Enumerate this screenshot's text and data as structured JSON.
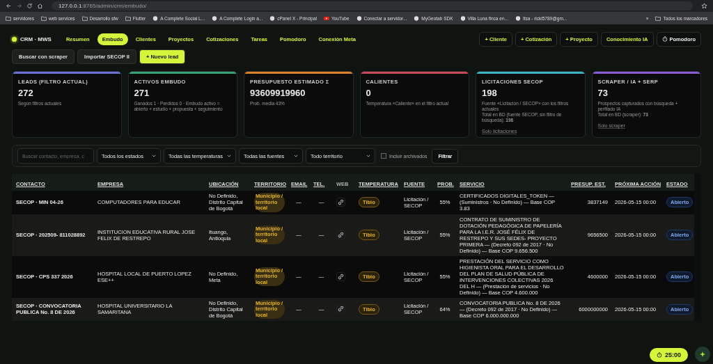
{
  "browser": {
    "url_host": "127.0.0.1",
    "url_path": ":8765/admin/crm/embudo/",
    "bookmarks": [
      {
        "kind": "folder",
        "label": "servidores"
      },
      {
        "kind": "folder",
        "label": "web services"
      },
      {
        "kind": "folder",
        "label": "Desarrollo sfw"
      },
      {
        "kind": "folder",
        "label": "Flutter"
      },
      {
        "kind": "site",
        "label": "A Complete Social L..."
      },
      {
        "kind": "site",
        "label": "A Complete Login a..."
      },
      {
        "kind": "site",
        "label": "cPanel X - Principal"
      },
      {
        "kind": "video",
        "label": "YouTube"
      },
      {
        "kind": "site",
        "label": "Conectar a servidor..."
      },
      {
        "kind": "site",
        "label": "MyGeotab SDK"
      },
      {
        "kind": "site",
        "label": "Villa Luna finca en..."
      },
      {
        "kind": "site",
        "label": "Itsa - ricki5789@gm..."
      }
    ],
    "more": "»",
    "all_bookmarks": "Todos los marcadores"
  },
  "brand": "CRM · MWS",
  "tabs": [
    {
      "label": "Resumen",
      "selected": false
    },
    {
      "label": "Embudo",
      "selected": true
    },
    {
      "label": "Clientes",
      "selected": false
    },
    {
      "label": "Proyectos",
      "selected": false
    },
    {
      "label": "Cotizaciones",
      "selected": false
    },
    {
      "label": "Tareas",
      "selected": false
    },
    {
      "label": "Pomodoro",
      "selected": false
    },
    {
      "label": "Conexión Meta",
      "selected": false
    }
  ],
  "actions": [
    {
      "label": "+ Cliente",
      "kind": "plain"
    },
    {
      "label": "+ Cotización",
      "kind": "plain"
    },
    {
      "label": "+ Proyecto",
      "kind": "plain"
    },
    {
      "label": "Conocimiento IA",
      "kind": "plain"
    },
    {
      "label": "Pomodoro",
      "kind": "timer"
    }
  ],
  "toolbar": [
    {
      "label": "Buscar con scraper",
      "primary": false
    },
    {
      "label": "Importar SECOP II",
      "primary": false
    },
    {
      "label": "+ Nuevo lead",
      "primary": true
    }
  ],
  "cards": [
    {
      "title": "LEADS (FILTRO ACTUAL)",
      "value": "272",
      "color": "#6b6fd6",
      "lines": [
        "Según filtros actuales"
      ]
    },
    {
      "title": "ACTIVOS EMBUDO",
      "value": "271",
      "color": "#3aa37a",
      "lines": [
        "Ganados 1 · Perdidos 0 · Embudo activo = abierto + estudio + propuesta + seguimiento"
      ]
    },
    {
      "title": "PRESUPUESTO ESTIMADO Σ",
      "value": "93609919960",
      "color": "#d9822b",
      "lines": [
        "Prob. media 43%"
      ]
    },
    {
      "title": "CALIENTES",
      "value": "0",
      "color": "#c94a5a",
      "lines": [
        "Temperatura «Caliente» en el filtro actual"
      ]
    },
    {
      "title": "LICITACIONES SECOP",
      "value": "198",
      "color": "#3bb4c4",
      "lines": [
        "Fuente «Licitación / SECOP» con los filtros actuales",
        "Total en BD (fuente SECOP, sin filtro de búsqueda): **198**"
      ],
      "link": "Solo licitaciones"
    },
    {
      "title": "SCRAPER / IA + SERP",
      "value": "73",
      "color": "#8a5cd6",
      "lines": [
        "Prospectos capturados con búsqueda + perfilado IA",
        "Total en BD (scraper): **73**"
      ],
      "link": "Solo scraper"
    }
  ],
  "filters": {
    "search_placeholder": "Buscar contacto, empresa, c",
    "selects": [
      "Todos los estados",
      "Todas las temperaturas",
      "Todas las fuentes",
      "Todo territorio"
    ],
    "archived": {
      "label": "Incluir archivados",
      "checked": false
    },
    "button": "Filtrar"
  },
  "table": {
    "columns": [
      {
        "label": "CONTACTO",
        "sortable": true
      },
      {
        "label": "EMPRESA",
        "sortable": true
      },
      {
        "label": "UBICACIÓN",
        "sortable": true
      },
      {
        "label": "TERRITORIO",
        "sortable": true
      },
      {
        "label": "EMAIL",
        "sortable": true
      },
      {
        "label": "TEL.",
        "sortable": true
      },
      {
        "label": "WEB",
        "sortable": false
      },
      {
        "label": "TEMPERATURA",
        "sortable": true
      },
      {
        "label": "FUENTE",
        "sortable": true
      },
      {
        "label": "PROB.",
        "sortable": true
      },
      {
        "label": "SERVICIO",
        "sortable": true
      },
      {
        "label": "PRESUP. EST.",
        "sortable": true
      },
      {
        "label": "PRÓXIMA ACCIÓN",
        "sortable": true
      },
      {
        "label": "ESTADO",
        "sortable": true
      }
    ],
    "rows": [
      {
        "contacto": "SECOP · MIN 04-26",
        "empresa": "COMPUTADORES PARA EDUCAR",
        "ubicacion": "No Definido, Distrito Capital de Bogotá",
        "territorio": "Municipio / territorio local",
        "email": "—",
        "tel": "—",
        "temperatura": "Tibio",
        "fuente": "Licitación / SECOP",
        "prob": "55%",
        "servicio": "CERTIFICADOS DIGITALES_TOKEN — (Suministros · No Definido) — Base COP 3.83",
        "presupuesto": "3837149",
        "proxima": "2026-05-15 00:00",
        "estado": "Abierto"
      },
      {
        "contacto": "SECOP · 202509- 811028892",
        "empresa": "INSTITUCION EDUCATIVA RURAL JOSE FELIX DE RESTREPO",
        "ubicacion": "Ituango, Antioquia",
        "territorio": "Municipio / territorio local",
        "email": "—",
        "tel": "—",
        "temperatura": "Tibio",
        "fuente": "Licitación / SECOP",
        "prob": "55%",
        "servicio": "CONTRATO DE SUMINISTRO DE DOTACIÓN PEDAGÓGICA DE PAPELERÍA PARA LA I.E.R. JOSÉ FÉLIX DE RESTREPO Y SUS SEDES- PROYECTO PRIMERA — (Decreto 092 de 2017 · No Definido) — Base COP 9.656.500",
        "presupuesto": "9656500",
        "proxima": "2026-05-15 00:00",
        "estado": "Abierto"
      },
      {
        "contacto": "SECOP · CPS 337 2026",
        "empresa": "HOSPITAL LOCAL DE PUERTO LOPEZ ESE++",
        "ubicacion": "No Definido, Meta",
        "territorio": "Municipio / territorio local",
        "email": "—",
        "tel": "—",
        "temperatura": "Tibio",
        "fuente": "Licitación / SECOP",
        "prob": "55%",
        "servicio": "PRESTACIÓN DEL SERVICIO COMO HIGIENISTA ORAL PARA EL DESARROLLO DEL PLAN DE SALUD PÚBLICA DE INTERVENCIONES COLECTIVAS 2026 DEL H — (Prestación de servicios · No Definido) — Base COP 4.600.000",
        "presupuesto": "4600000",
        "proxima": "2026-05-15 00:00",
        "estado": "Abierto"
      },
      {
        "contacto": "SECOP · CONVOCATORIA PUBLICA No. 8 DE 2026",
        "empresa": "HOSPITAL UNIVERSITARIO LA SAMARITANA",
        "ubicacion": "No Definido, Distrito Capital de Bogotá",
        "territorio": "Municipio / territorio local",
        "email": "—",
        "tel": "—",
        "temperatura": "Tibio",
        "fuente": "Licitación / SECOP",
        "prob": "64%",
        "servicio": "CONVOCATORIA PUBLICA No. 8 DE 2026 — (Decreto 092 de 2017 · No Definido) — Base COP 6.000.000.000",
        "presupuesto": "6000000000",
        "proxima": "2026-05-15 00:00",
        "estado": "Abierto"
      }
    ]
  },
  "timer": {
    "label": "25:00"
  }
}
